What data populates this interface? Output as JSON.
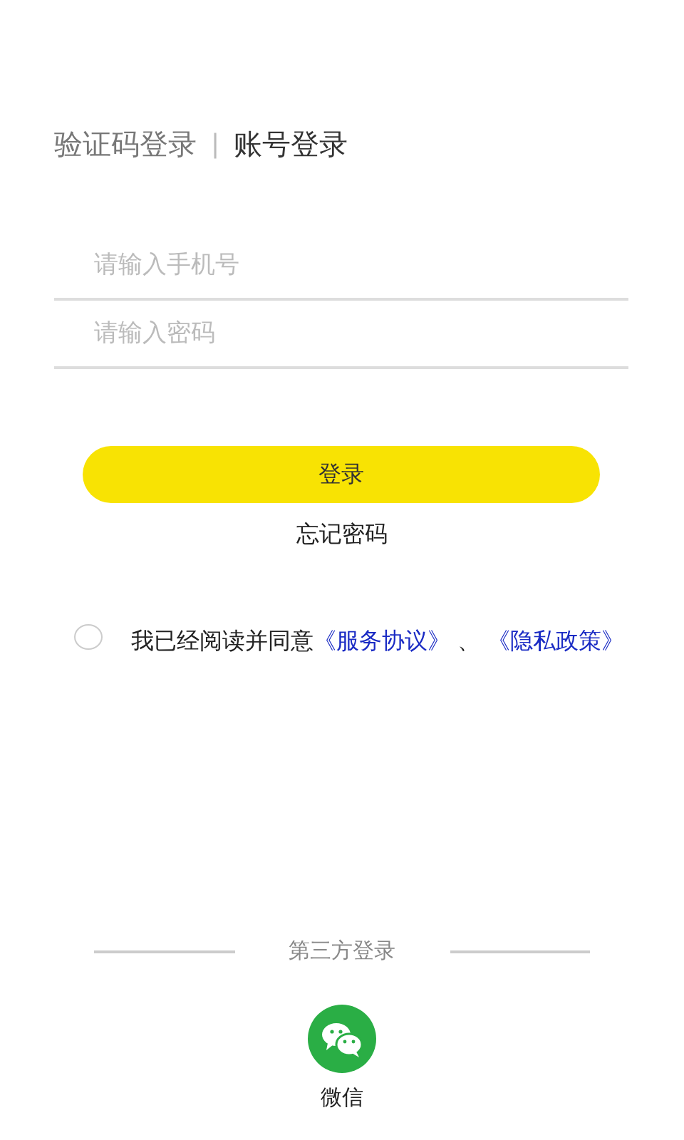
{
  "tabs": [
    {
      "label": "验证码登录",
      "selected": false
    },
    {
      "label": "账号登录",
      "selected": true
    }
  ],
  "tab_separator": "|",
  "fields": [
    {
      "placeholder": "请输入手机号"
    },
    {
      "placeholder": "请输入密码"
    }
  ],
  "login_button": "登录",
  "forgot_password": "忘记密码",
  "agreement": {
    "checked": false,
    "text": "我已经阅读并同意",
    "links": [
      "《服务协议》",
      "《隐私政策》"
    ],
    "joiner": "、"
  },
  "third_party": {
    "title": "第三方登录",
    "providers": [
      {
        "label": "微信"
      }
    ]
  }
}
